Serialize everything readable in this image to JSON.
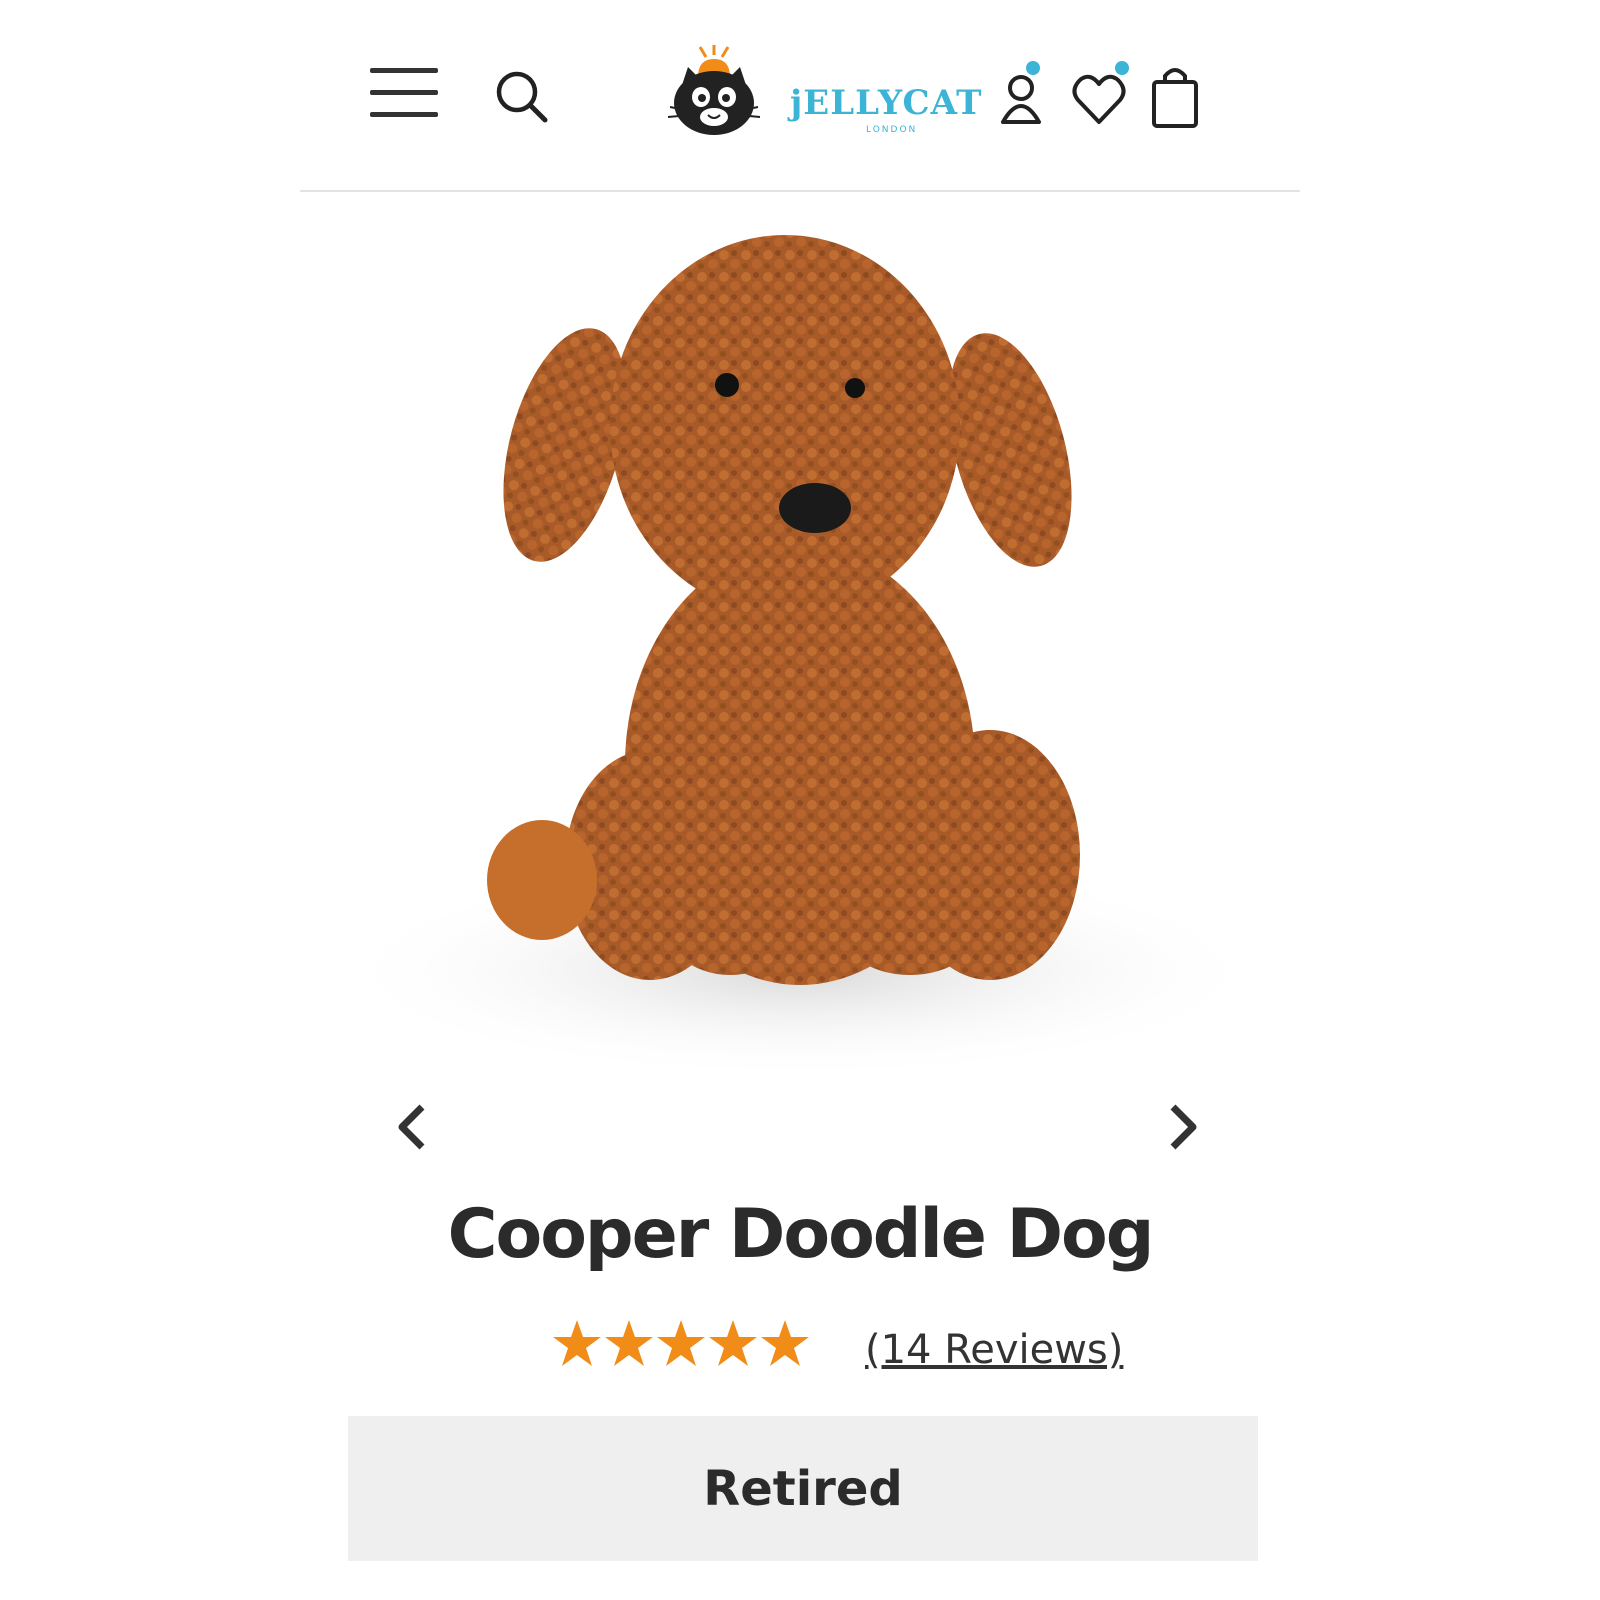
{
  "brand": {
    "name": "jELLYCAT",
    "subtitle": "LONDON"
  },
  "header": {
    "icons": [
      "menu-icon",
      "search-icon",
      "account-icon",
      "wishlist-heart-icon",
      "shopping-bag-icon"
    ],
    "accent_color": "#3cb4d6"
  },
  "product": {
    "title": "Cooper Doodle Dog",
    "rating": 5,
    "rating_max": 5,
    "reviews_label": "(14 Reviews)",
    "status_label": "Retired",
    "star_color": "#f28c18"
  }
}
